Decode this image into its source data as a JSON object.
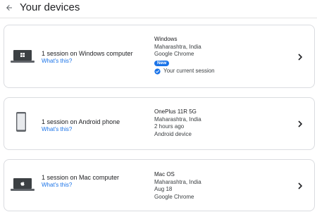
{
  "header": {
    "back_icon": "arrow-left-icon",
    "title": "Your devices"
  },
  "devices": [
    {
      "session_label": "1 session on Windows computer",
      "whats_this": "What's this?",
      "icon": "windows-laptop-icon",
      "details_title": "Windows",
      "location": "Maharashtra, India",
      "browser": "Google Chrome",
      "badge": "New",
      "current_session": "Your current session"
    },
    {
      "session_label": "1 session on Android phone",
      "whats_this": "What's this?",
      "icon": "android-phone-icon",
      "details_title": "OnePlus 11R 5G",
      "location": "Maharashtra, India",
      "last_active": "2 hours ago",
      "device_type": "Android device"
    },
    {
      "session_label": "1 session on Mac computer",
      "whats_this": "What's this?",
      "icon": "mac-laptop-icon",
      "details_title": "Mac OS",
      "location": "Maharashtra, India",
      "last_active": "Aug 18",
      "browser": "Google Chrome"
    }
  ],
  "colors": {
    "accent": "#1a73e8",
    "border": "#dadce0",
    "text": "#202124"
  }
}
